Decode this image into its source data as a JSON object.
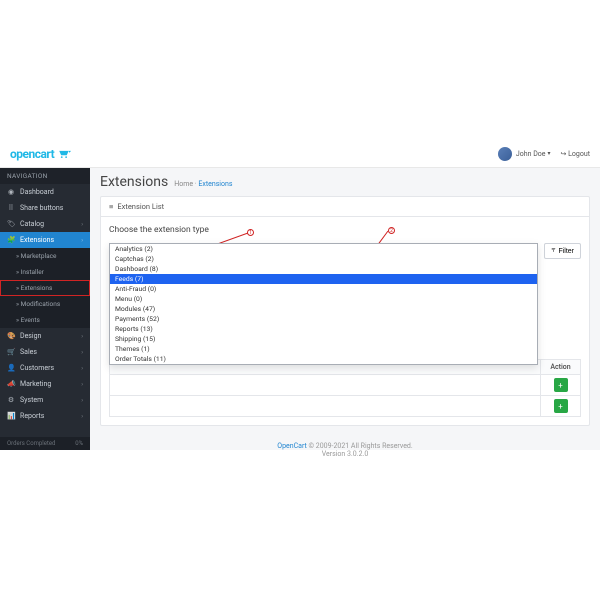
{
  "brand": {
    "name": "opencart"
  },
  "header": {
    "user": "John Doe",
    "logout": "Logout"
  },
  "sidebar": {
    "heading": "NAVIGATION",
    "items": [
      {
        "icon": "◉",
        "label": "Dashboard"
      },
      {
        "icon": "⠿",
        "label": "Share buttons"
      },
      {
        "icon": "🏷",
        "label": "Catalog",
        "chev": true
      },
      {
        "icon": "🧩",
        "label": "Extensions",
        "chev": true,
        "active": true
      },
      {
        "icon": "🎨",
        "label": "Design",
        "chev": true
      },
      {
        "icon": "🛒",
        "label": "Sales",
        "chev": true
      },
      {
        "icon": "👤",
        "label": "Customers",
        "chev": true
      },
      {
        "icon": "📣",
        "label": "Marketing",
        "chev": true
      },
      {
        "icon": "⚙",
        "label": "System",
        "chev": true
      },
      {
        "icon": "📊",
        "label": "Reports",
        "chev": true
      }
    ],
    "sub": [
      {
        "label": "Marketplace"
      },
      {
        "label": "Installer"
      },
      {
        "label": "Extensions",
        "hl": true
      },
      {
        "label": "Modifications"
      },
      {
        "label": "Events"
      }
    ],
    "footer": {
      "left": "Orders Completed",
      "right": "0%"
    }
  },
  "page": {
    "title": "Extensions",
    "crumb_home": "Home",
    "crumb_here": "Extensions",
    "panel_title": "Extension List",
    "prompt": "Choose the extension type",
    "filter_btn": "Filter",
    "dropdown": [
      "Analytics (2)",
      "Captchas (2)",
      "Dashboard (8)",
      "Feeds (7)",
      "Anti-Fraud (0)",
      "Menu (0)",
      "Modules (47)",
      "Payments (52)",
      "Reports (13)",
      "Shipping (15)",
      "Themes (1)",
      "Order Totals (11)"
    ],
    "dropdown_selected": 3,
    "table": {
      "col_action": "Action"
    }
  },
  "footer": {
    "copyright": "© 2009-2021 All Rights Reserved.",
    "link": "OpenCart",
    "version": "Version 3.0.2.0"
  },
  "ann": {
    "b1": "1",
    "b2": "2"
  }
}
